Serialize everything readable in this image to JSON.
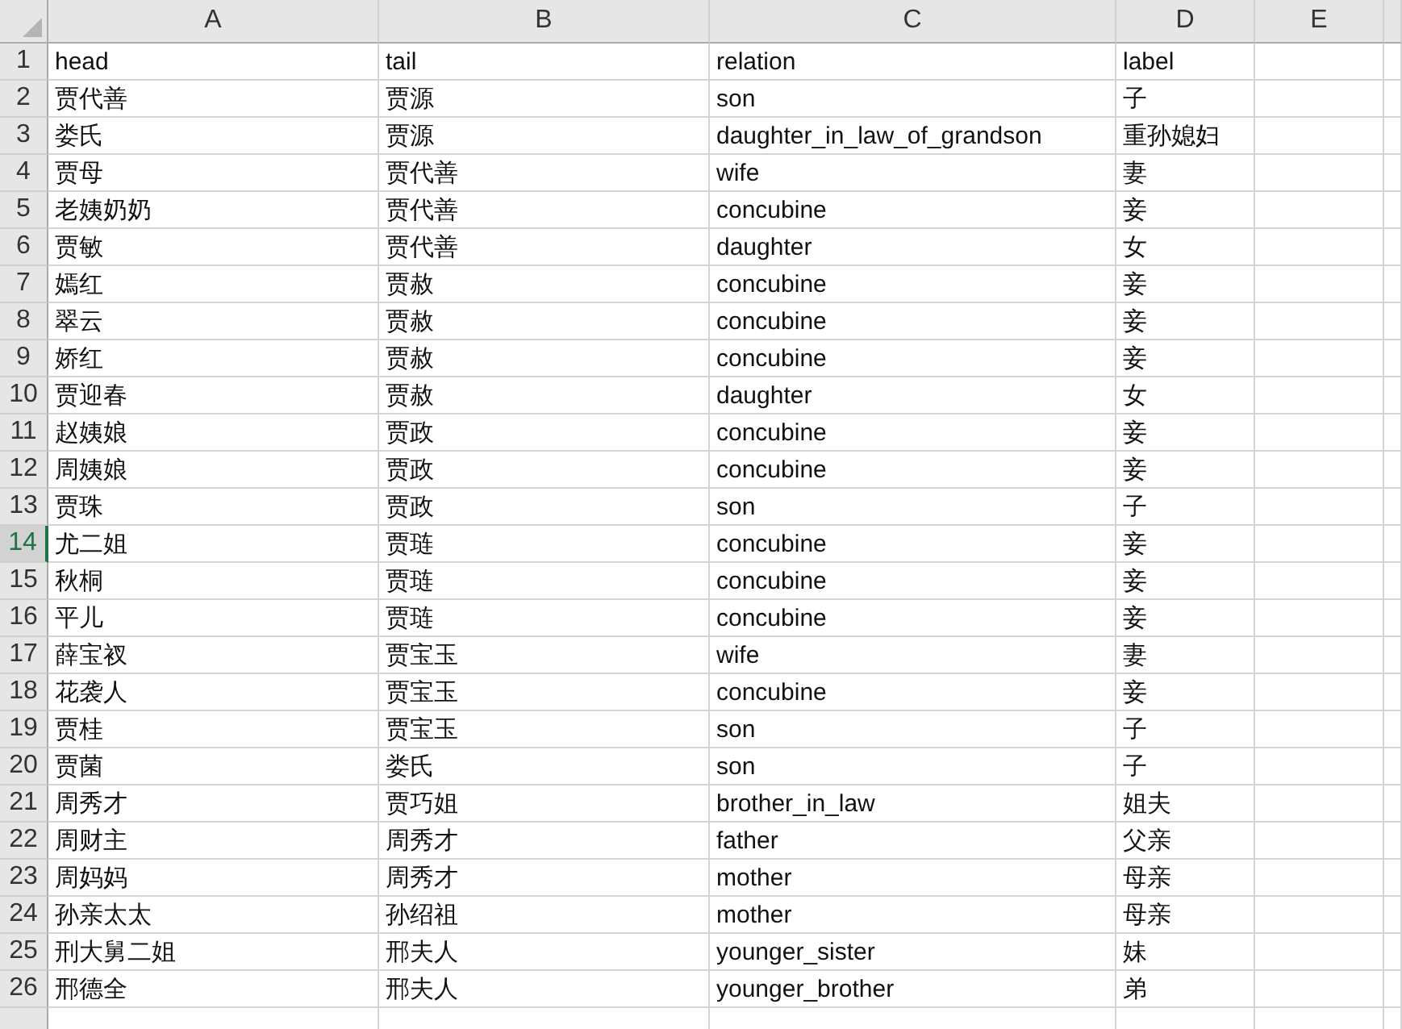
{
  "columns": [
    {
      "label": "A"
    },
    {
      "label": "B"
    },
    {
      "label": "C"
    },
    {
      "label": "D"
    },
    {
      "label": "E"
    }
  ],
  "rows": [
    {
      "number": "1",
      "selected": false,
      "cells": [
        "head",
        "tail",
        "relation",
        "label"
      ]
    },
    {
      "number": "2",
      "selected": false,
      "cells": [
        "贾代善",
        "贾源",
        "son",
        "子"
      ]
    },
    {
      "number": "3",
      "selected": false,
      "cells": [
        "娄氏",
        "贾源",
        "daughter_in_law_of_grandson",
        "重孙媳妇"
      ]
    },
    {
      "number": "4",
      "selected": false,
      "cells": [
        "贾母",
        "贾代善",
        "wife",
        "妻"
      ]
    },
    {
      "number": "5",
      "selected": false,
      "cells": [
        "老姨奶奶",
        "贾代善",
        "concubine",
        "妾"
      ]
    },
    {
      "number": "6",
      "selected": false,
      "cells": [
        "贾敏",
        "贾代善",
        "daughter",
        "女"
      ]
    },
    {
      "number": "7",
      "selected": false,
      "cells": [
        "嫣红",
        "贾赦",
        "concubine",
        "妾"
      ]
    },
    {
      "number": "8",
      "selected": false,
      "cells": [
        "翠云",
        "贾赦",
        "concubine",
        "妾"
      ]
    },
    {
      "number": "9",
      "selected": false,
      "cells": [
        "娇红",
        "贾赦",
        "concubine",
        "妾"
      ]
    },
    {
      "number": "10",
      "selected": false,
      "cells": [
        "贾迎春",
        "贾赦",
        "daughter",
        "女"
      ]
    },
    {
      "number": "11",
      "selected": false,
      "cells": [
        "赵姨娘",
        "贾政",
        "concubine",
        "妾"
      ]
    },
    {
      "number": "12",
      "selected": false,
      "cells": [
        "周姨娘",
        "贾政",
        "concubine",
        "妾"
      ]
    },
    {
      "number": "13",
      "selected": false,
      "cells": [
        "贾珠",
        "贾政",
        "son",
        "子"
      ]
    },
    {
      "number": "14",
      "selected": true,
      "cells": [
        "尤二姐",
        "贾琏",
        "concubine",
        "妾"
      ]
    },
    {
      "number": "15",
      "selected": false,
      "cells": [
        "秋桐",
        "贾琏",
        "concubine",
        "妾"
      ]
    },
    {
      "number": "16",
      "selected": false,
      "cells": [
        "平儿",
        "贾琏",
        "concubine",
        "妾"
      ]
    },
    {
      "number": "17",
      "selected": false,
      "cells": [
        "薛宝衩",
        "贾宝玉",
        "wife",
        "妻"
      ]
    },
    {
      "number": "18",
      "selected": false,
      "cells": [
        "花袭人",
        "贾宝玉",
        "concubine",
        "妾"
      ]
    },
    {
      "number": "19",
      "selected": false,
      "cells": [
        "贾桂",
        "贾宝玉",
        "son",
        "子"
      ]
    },
    {
      "number": "20",
      "selected": false,
      "cells": [
        "贾菌",
        "娄氏",
        "son",
        "子"
      ]
    },
    {
      "number": "21",
      "selected": false,
      "cells": [
        "周秀才",
        "贾巧姐",
        "brother_in_law",
        "姐夫"
      ]
    },
    {
      "number": "22",
      "selected": false,
      "cells": [
        "周财主",
        "周秀才",
        "father",
        "父亲"
      ]
    },
    {
      "number": "23",
      "selected": false,
      "cells": [
        "周妈妈",
        "周秀才",
        "mother",
        "母亲"
      ]
    },
    {
      "number": "24",
      "selected": false,
      "cells": [
        "孙亲太太",
        "孙绍祖",
        "mother",
        "母亲"
      ]
    },
    {
      "number": "25",
      "selected": false,
      "cells": [
        "刑大舅二姐",
        "邢夫人",
        "younger_sister",
        "妹"
      ]
    },
    {
      "number": "26",
      "selected": false,
      "cells": [
        "邢德全",
        "邢夫人",
        "younger_brother",
        "弟"
      ]
    }
  ]
}
